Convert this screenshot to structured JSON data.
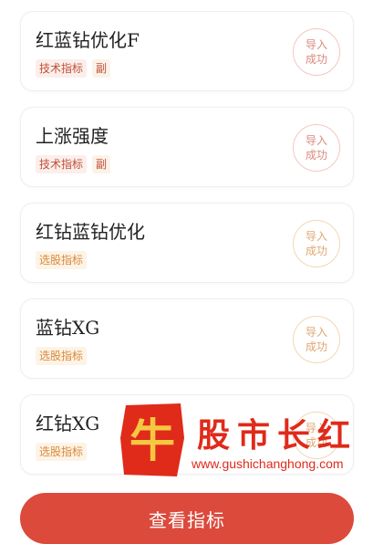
{
  "cards": [
    {
      "title": "红蓝钻优化F",
      "tags": [
        {
          "label": "技术指标",
          "kind": "tech"
        },
        {
          "label": "副",
          "kind": "sub"
        }
      ],
      "stamp": {
        "line1": "导入",
        "line2": "成功",
        "tone": "red"
      }
    },
    {
      "title": "上涨强度",
      "tags": [
        {
          "label": "技术指标",
          "kind": "tech"
        },
        {
          "label": "副",
          "kind": "sub"
        }
      ],
      "stamp": {
        "line1": "导入",
        "line2": "成功",
        "tone": "red"
      }
    },
    {
      "title": "红钻蓝钻优化",
      "tags": [
        {
          "label": "选股指标",
          "kind": "pick"
        }
      ],
      "stamp": {
        "line1": "导入",
        "line2": "成功",
        "tone": "orange"
      }
    },
    {
      "title": "蓝钻XG",
      "tags": [
        {
          "label": "选股指标",
          "kind": "pick"
        }
      ],
      "stamp": {
        "line1": "导入",
        "line2": "成功",
        "tone": "orange"
      }
    },
    {
      "title": "红钻XG",
      "tags": [
        {
          "label": "选股指标",
          "kind": "pick"
        }
      ],
      "stamp": {
        "line1": "导入",
        "line2": "成功",
        "tone": "orange"
      }
    }
  ],
  "bottom_button": {
    "label": "查看指标"
  },
  "watermark": {
    "logo_char": "牛",
    "title": "股市长红",
    "url": "www.gushichanghong.com"
  },
  "colors": {
    "accent": "#dc4a3c",
    "watermark": "#e02a1a"
  }
}
